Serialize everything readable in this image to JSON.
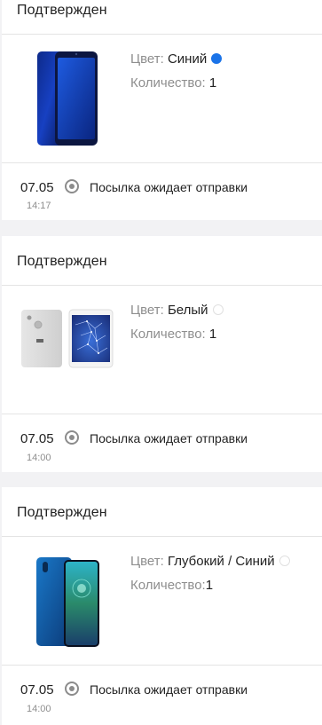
{
  "orders": [
    {
      "status": "Подтвержден",
      "color_label": "Цвет: ",
      "color_value": "Синий",
      "color_swatch": "#1a73e8",
      "qty_label": "Количество: ",
      "qty_value": "1",
      "date": "07.05",
      "time": "14:17",
      "tracking_text": "Посылка ожидает отправки",
      "product_icon": "phone-blue-icon"
    },
    {
      "status": "Подтвержден",
      "color_label": "Цвет: ",
      "color_value": "Белый",
      "color_swatch": "#ffffff",
      "qty_label": "Количество: ",
      "qty_value": "1",
      "date": "07.05",
      "time": "14:00",
      "tracking_text": "Посылка ожидает отправки",
      "product_icon": "phone-white-icon"
    },
    {
      "status": "Подтвержден",
      "color_label": "Цвет: ",
      "color_value": "Глубокий / Синий",
      "color_swatch": "#ffffff",
      "qty_label": "Количество:",
      "qty_value": "1",
      "date": "07.05",
      "time": "14:00",
      "tracking_text": "Посылка ожидает отправки",
      "product_icon": "phone-deep-blue-icon"
    }
  ]
}
